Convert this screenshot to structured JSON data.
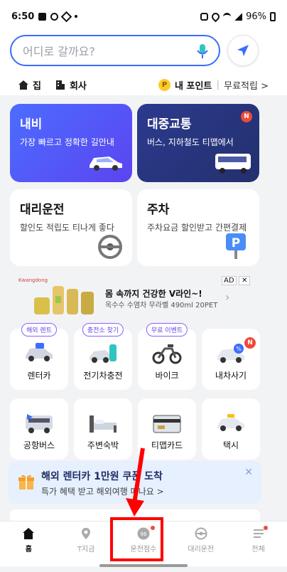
{
  "status": {
    "time": "6:50",
    "battery": "96%"
  },
  "search": {
    "placeholder": "어디로 갈까요?"
  },
  "shortcuts": {
    "home": "집",
    "work": "회사",
    "points": "내 포인트",
    "points_coin": "P",
    "free": "무료적립 >"
  },
  "cards": {
    "navi": {
      "title": "내비",
      "desc": "가장 빠르고 정확한 길안내"
    },
    "transit": {
      "title": "대중교통",
      "desc": "버스, 지하철도 티맵에서",
      "badge": "N"
    },
    "driver": {
      "title": "대리운전",
      "desc": "할인도 적립도 티나게 좋다"
    },
    "parking": {
      "title": "주차",
      "desc": "주차요금 할인받고 간편결제"
    }
  },
  "ad": {
    "brand": "Kwangdong",
    "title": "몸 속까지 건강한 V라인~!",
    "subtitle": "옥수수 수염차 무라벨 490ml 20PET",
    "label": "AD",
    "close": "✕",
    "arrow": "›"
  },
  "tiles": [
    {
      "label": "렌터카",
      "pill": "해외 렌트"
    },
    {
      "label": "전기차충전",
      "pill": "충전소 찾기"
    },
    {
      "label": "바이크",
      "pill": "무료 이벤트"
    },
    {
      "label": "내차사기",
      "badge": "N"
    },
    {
      "label": "공항버스"
    },
    {
      "label": "주변숙박"
    },
    {
      "label": "티맵카드"
    },
    {
      "label": "택시"
    }
  ],
  "promo": {
    "title": "해외 렌터카 1만원 쿠폰 도착",
    "subtitle": "특가 혜택 받고 해외여행 떠나요 >",
    "close": "✕"
  },
  "nav": {
    "home": "홈",
    "tnow": "T지금",
    "score": "운전점수",
    "score_value": "96",
    "driver": "대리운전",
    "all": "전체"
  },
  "colors": {
    "accent": "#3b6cff",
    "navi": "#4b6dff",
    "transit": "#2c3a8e",
    "highlight": "#ff0000",
    "badge": "#f04a3a"
  }
}
